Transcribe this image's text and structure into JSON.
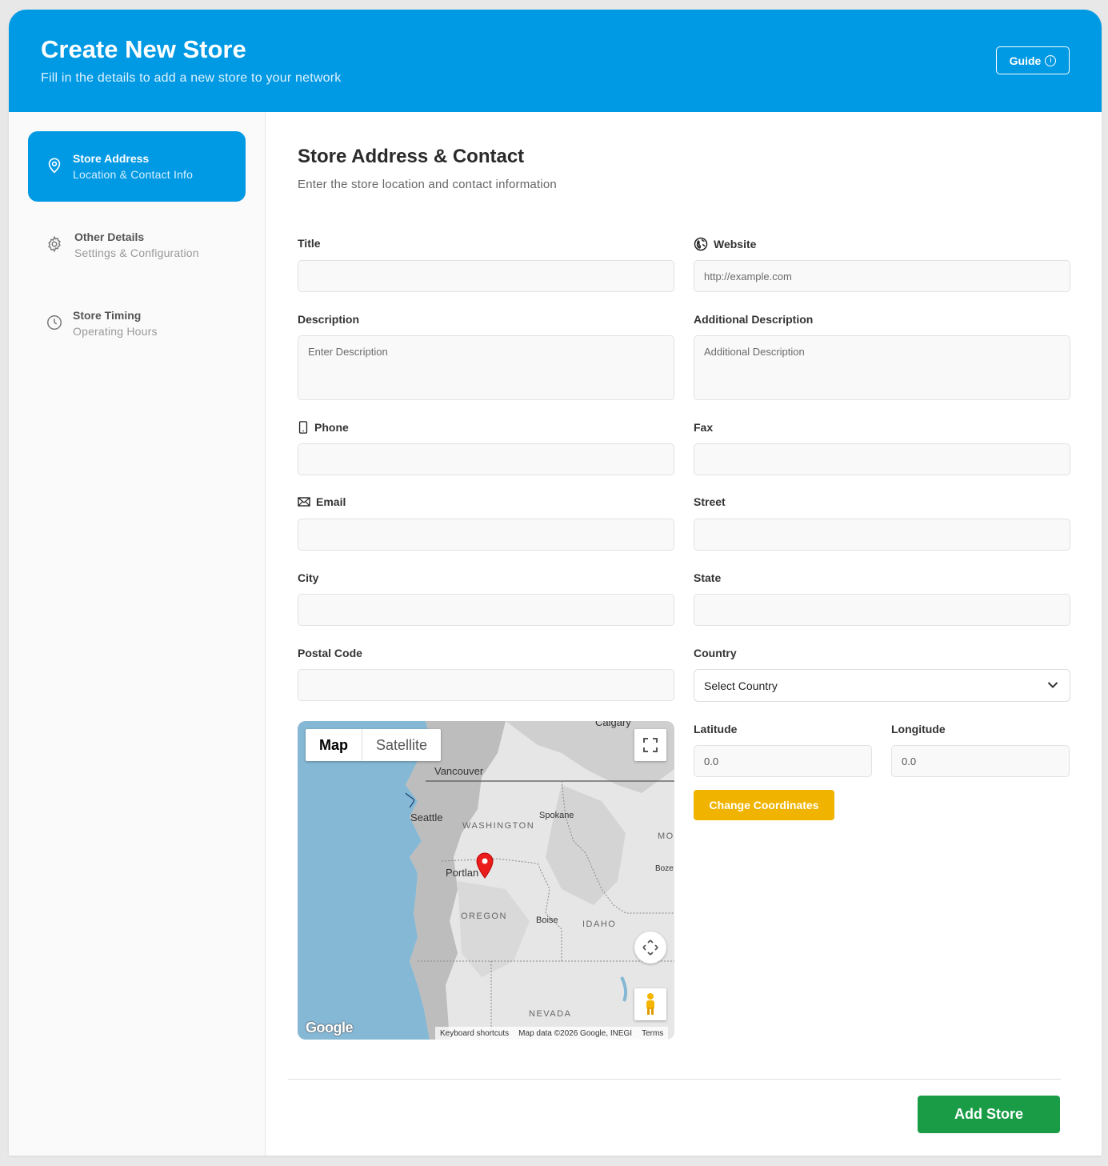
{
  "header": {
    "title": "Create New Store",
    "subtitle": "Fill in the details to add a new store to your network",
    "guide_label": "Guide",
    "guide_icon": "info-icon"
  },
  "sidebar": {
    "steps": [
      {
        "title": "Store Address",
        "subtitle": "Location & Contact Info",
        "icon": "map-pin-icon",
        "active": true
      },
      {
        "title": "Other Details",
        "subtitle": "Settings & Configuration",
        "icon": "gear-icon",
        "active": false
      },
      {
        "title": "Store Timing",
        "subtitle": "Operating Hours",
        "icon": "clock-icon",
        "active": false
      }
    ]
  },
  "main": {
    "title": "Store Address & Contact",
    "subtitle": "Enter the store location and contact information"
  },
  "form": {
    "title": {
      "label": "Title",
      "value": "",
      "placeholder": ""
    },
    "website": {
      "label": "Website",
      "value": "",
      "placeholder": "http://example.com",
      "icon": "globe-icon"
    },
    "description": {
      "label": "Description",
      "value": "",
      "placeholder": "Enter Description"
    },
    "additional_description": {
      "label": "Additional Description",
      "value": "",
      "placeholder": "Additional Description"
    },
    "phone": {
      "label": "Phone",
      "value": "",
      "placeholder": "",
      "icon": "mobile-phone-icon"
    },
    "fax": {
      "label": "Fax",
      "value": "",
      "placeholder": ""
    },
    "email": {
      "label": "Email",
      "value": "",
      "placeholder": "",
      "icon": "envelope-icon"
    },
    "street": {
      "label": "Street",
      "value": "",
      "placeholder": ""
    },
    "city": {
      "label": "City",
      "value": "",
      "placeholder": ""
    },
    "state": {
      "label": "State",
      "value": "",
      "placeholder": ""
    },
    "postal_code": {
      "label": "Postal Code",
      "value": "",
      "placeholder": ""
    },
    "country": {
      "label": "Country",
      "selected": "Select Country"
    },
    "latitude": {
      "label": "Latitude",
      "value": "0.0"
    },
    "longitude": {
      "label": "Longitude",
      "value": "0.0"
    },
    "change_coordinates_label": "Change Coordinates"
  },
  "map": {
    "type_map": "Map",
    "type_satellite": "Satellite",
    "places": {
      "calgary": "Calgary",
      "vancouver": "Vancouver",
      "seattle": "Seattle",
      "spokane": "Spokane",
      "washington": "WASHINGTON",
      "mo": "MO",
      "portland": "Portlan",
      "boze": "Boze",
      "oregon": "OREGON",
      "boise": "Boise",
      "idaho": "IDAHO",
      "nevada": "NEVADA"
    },
    "google_logo": "Google",
    "keyboard_shortcuts": "Keyboard shortcuts",
    "map_data": "Map data ©2026 Google, INEGI",
    "terms": "Terms"
  },
  "footer": {
    "add_store_label": "Add Store"
  },
  "colors": {
    "primary": "#0099e3",
    "accent_yellow": "#f0b400",
    "success_green": "#1a9c47"
  }
}
